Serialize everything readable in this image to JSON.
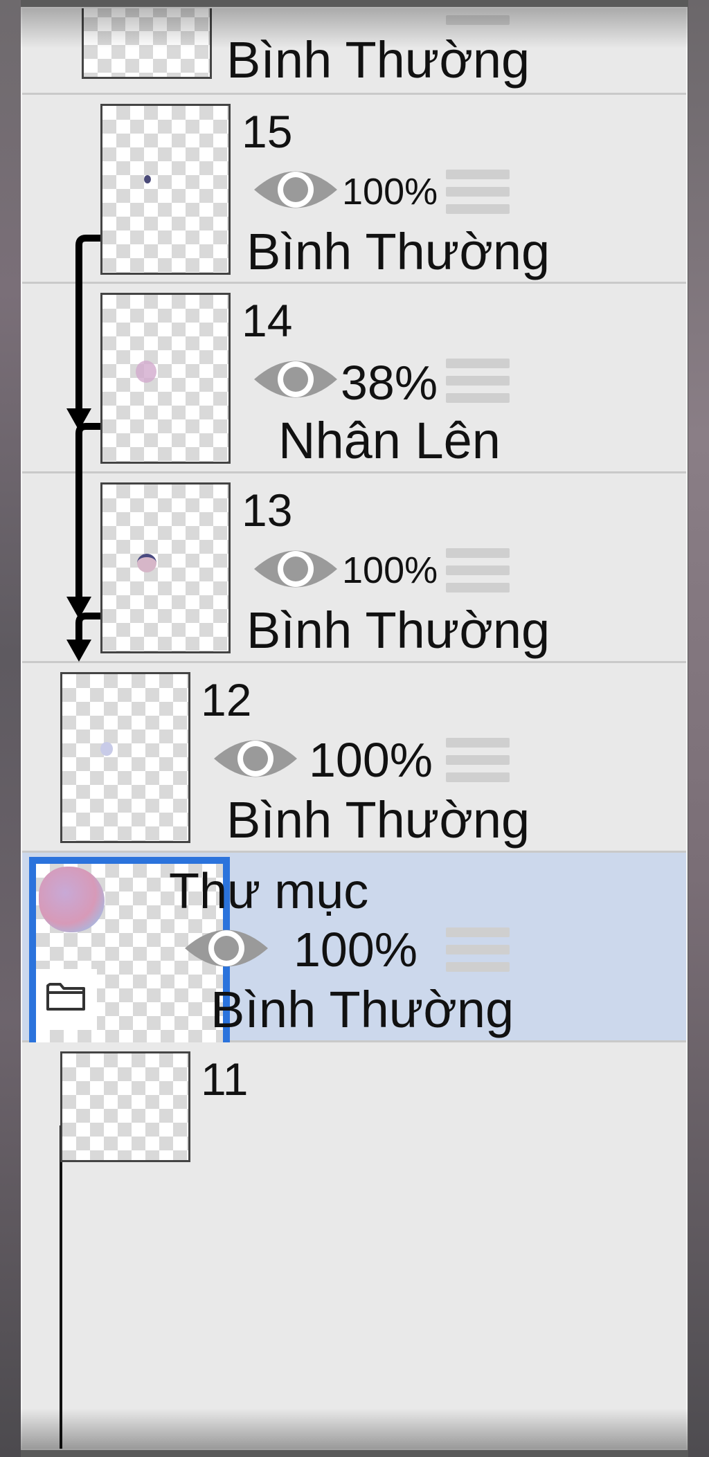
{
  "layers": [
    {
      "id": "top",
      "number": "",
      "opacity": "",
      "blend": "Bình Thường",
      "visible": true
    },
    {
      "id": "15",
      "number": "15",
      "opacity": "100%",
      "blend": "Bình Thường",
      "visible": true,
      "clipped": true
    },
    {
      "id": "14",
      "number": "14",
      "opacity": "38%",
      "blend": "Nhân Lên",
      "visible": true,
      "clipped": true
    },
    {
      "id": "13",
      "number": "13",
      "opacity": "100%",
      "blend": "Bình Thường",
      "visible": true,
      "clipped": true
    },
    {
      "id": "12",
      "number": "12",
      "opacity": "100%",
      "blend": "Bình Thường",
      "visible": true
    },
    {
      "id": "folder",
      "name": "Thư mục",
      "opacity": "100%",
      "blend": "Bình Thường",
      "visible": true,
      "selected": true
    },
    {
      "id": "11",
      "number": "11"
    }
  ],
  "icons": {
    "visibility": "eye-icon",
    "reorder": "drag-handle-icon",
    "folder": "folder-icon",
    "clipping": "clip-arrow-icon"
  },
  "colors": {
    "selected_row": "#ccd8ec",
    "selected_border": "#2b73dc",
    "panel_bg": "#e9e9e9"
  }
}
